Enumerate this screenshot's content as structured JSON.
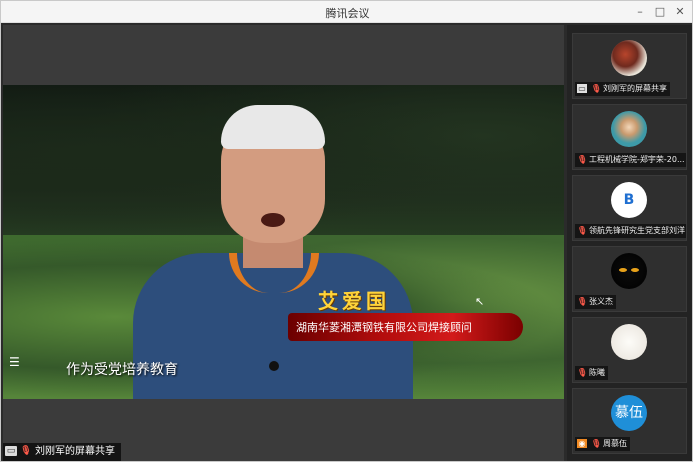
{
  "window": {
    "title": "腾讯会议",
    "controls": {
      "minimize": "–",
      "maximize": "□",
      "close": "✕"
    }
  },
  "screen_share": {
    "lower_third": {
      "name": "艾爱国",
      "title": "湖南华菱湘潭钢铁有限公司焊接顾问"
    },
    "subtitle": "作为受党培养教育",
    "menu_glyph": "☰",
    "cursor_glyph": "↖",
    "presenter_label": "刘刚军的屏幕共享"
  },
  "participants": [
    {
      "name": "刘刚军的屏幕共享",
      "avatar": "photo-avatar",
      "icons": [
        "screen-share-icon",
        "mic-muted-icon"
      ]
    },
    {
      "name": "工程机械学院-郑宇荣-20...",
      "avatar": "photo-avatar",
      "icons": [
        "mic-muted-icon"
      ]
    },
    {
      "name": "领航先锋研究生党支部刘洋",
      "avatar": "logo-avatar",
      "icons": [
        "mic-muted-icon"
      ]
    },
    {
      "name": "张义杰",
      "avatar": "dark-cat-avatar",
      "icons": [
        "mic-muted-icon"
      ]
    },
    {
      "name": "陈曦",
      "avatar": "light-avatar",
      "icons": [
        "mic-muted-icon"
      ]
    },
    {
      "name": "周慕伍",
      "avatar": "initials-avatar",
      "initials": "慕伍",
      "icons": [
        "user-icon",
        "mic-muted-icon"
      ]
    }
  ],
  "colors": {
    "accent_blue": "#1f8fd8",
    "ribbon_red": "#b30d0d",
    "name_gold": "#ffd43a",
    "muted_red": "#ff5a4a"
  }
}
